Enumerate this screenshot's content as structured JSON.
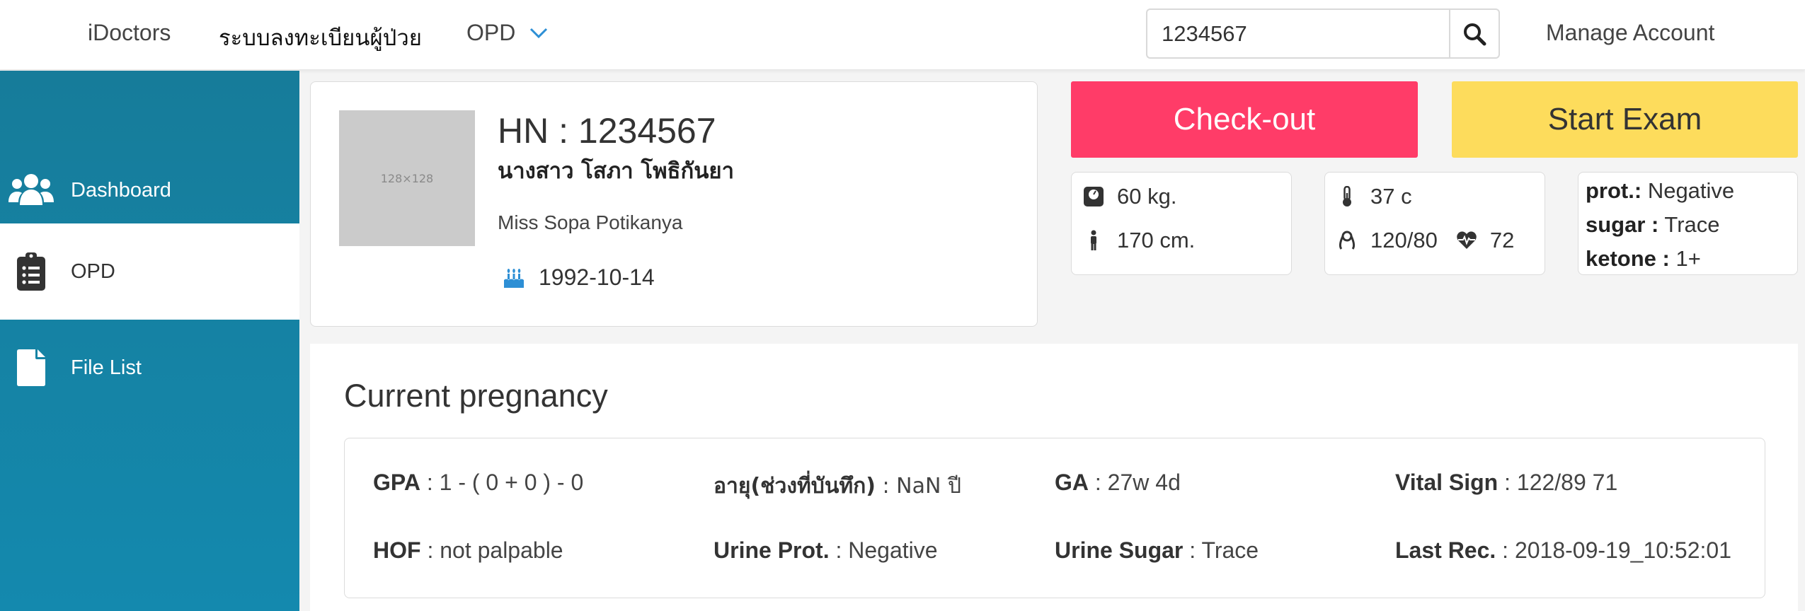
{
  "nav": {
    "brand": "iDoctors",
    "register": "ระบบลงทะเบียนผู้ป่วย",
    "opd": "OPD",
    "search_value": "1234567",
    "account": "Manage Account"
  },
  "sidebar": {
    "items": [
      {
        "label": "Dashboard",
        "icon": "users-icon"
      },
      {
        "label": "OPD",
        "icon": "clipboard-list-icon",
        "active": true
      },
      {
        "label": "File List",
        "icon": "file-icon"
      }
    ]
  },
  "patient": {
    "avatar_text": "128×128",
    "hn": "HN : 1234567",
    "name_th": "นางสาว โสภา โพธิกันยา",
    "name_en": "Miss Sopa Potikanya",
    "dob": "1992-10-14"
  },
  "actions": {
    "checkout": "Check-out",
    "start_exam": "Start Exam"
  },
  "vitals": {
    "weight": "60 kg.",
    "height": "170 cm.",
    "temp": "37 c",
    "bp": "120/80",
    "pulse": "72",
    "urine": {
      "prot_label": "prot.:",
      "prot_value": " Negative",
      "sugar_label": "sugar :",
      "sugar_value": " Trace",
      "ketone_label": "ketone :",
      "ketone_value": " 1+"
    }
  },
  "pregnancy": {
    "title": "Current pregnancy",
    "fields": [
      {
        "label": "GPA",
        "value": " : 1 - ( 0 + 0 ) - 0"
      },
      {
        "label": "อายุ(ช่วงที่บันทึก)",
        "value": " : NaN ปี"
      },
      {
        "label": "GA",
        "value": " : 27w 4d"
      },
      {
        "label": "Vital Sign",
        "value": " : 122/89 71"
      },
      {
        "label": "HOF",
        "value": " : not palpable"
      },
      {
        "label": "Urine Prot.",
        "value": " : Negative"
      },
      {
        "label": "Urine Sugar",
        "value": " : Trace"
      },
      {
        "label": "Last Rec.",
        "value": " : 2018-09-19_10:52:01"
      }
    ]
  },
  "colors": {
    "sidebar": "#1583a6",
    "checkout": "#ff3c68",
    "start_exam": "#fddc5c",
    "accent_icon": "#2d8fd5"
  }
}
